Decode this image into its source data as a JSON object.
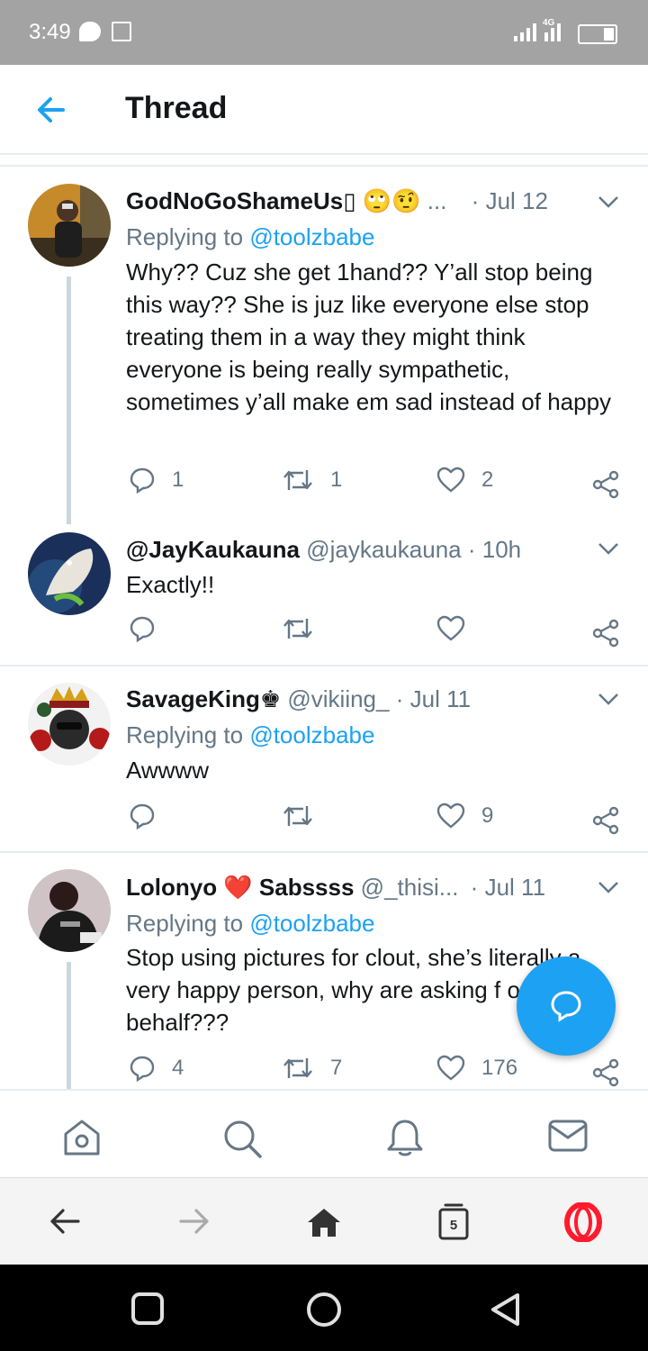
{
  "status_bar": {
    "time": "3:49",
    "network": "4G"
  },
  "header": {
    "title": "Thread"
  },
  "tweets": [
    {
      "name": "GodNoGoShameUs▯ 🙄🤨",
      "ellipsis": "...",
      "handle": "",
      "time": "Jul 12",
      "reply_prefix": "Replying to",
      "reply_to": "@toolzbabe",
      "body": "Why?? Cuz she get 1hand?? Y’all stop being this way?? She is juz like everyone else stop treating them in a way they might think everyone is being really sympathetic, sometimes y’all make em sad instead of happy",
      "replies": "1",
      "retweets": "1",
      "likes": "2"
    },
    {
      "name": "@JayKaukauna",
      "handle": "@jaykaukauna",
      "time": "10h",
      "body": "Exactly!!",
      "replies": "",
      "retweets": "",
      "likes": ""
    },
    {
      "name": "SavageKing♚",
      "handle": "@vikiing_",
      "time": "Jul 11",
      "reply_prefix": "Replying to",
      "reply_to": "@toolzbabe",
      "body": "Awwww",
      "replies": "",
      "retweets": "",
      "likes": "9"
    },
    {
      "name": "Lolonyo ❤️ Sabssss",
      "handle": "@_thisi...",
      "time": "Jul 11",
      "reply_prefix": "Replying to",
      "reply_to": "@toolzbabe",
      "body": "Stop using pictures for clout, she’s literally a very happy person, why are asking f on her behalf???",
      "replies": "4",
      "retweets": "7",
      "likes": "176"
    }
  ],
  "browser": {
    "tab_count": "5"
  },
  "colors": {
    "accent": "#1da1f2",
    "secondary_text": "#657786",
    "divider": "#e6ecf0"
  }
}
